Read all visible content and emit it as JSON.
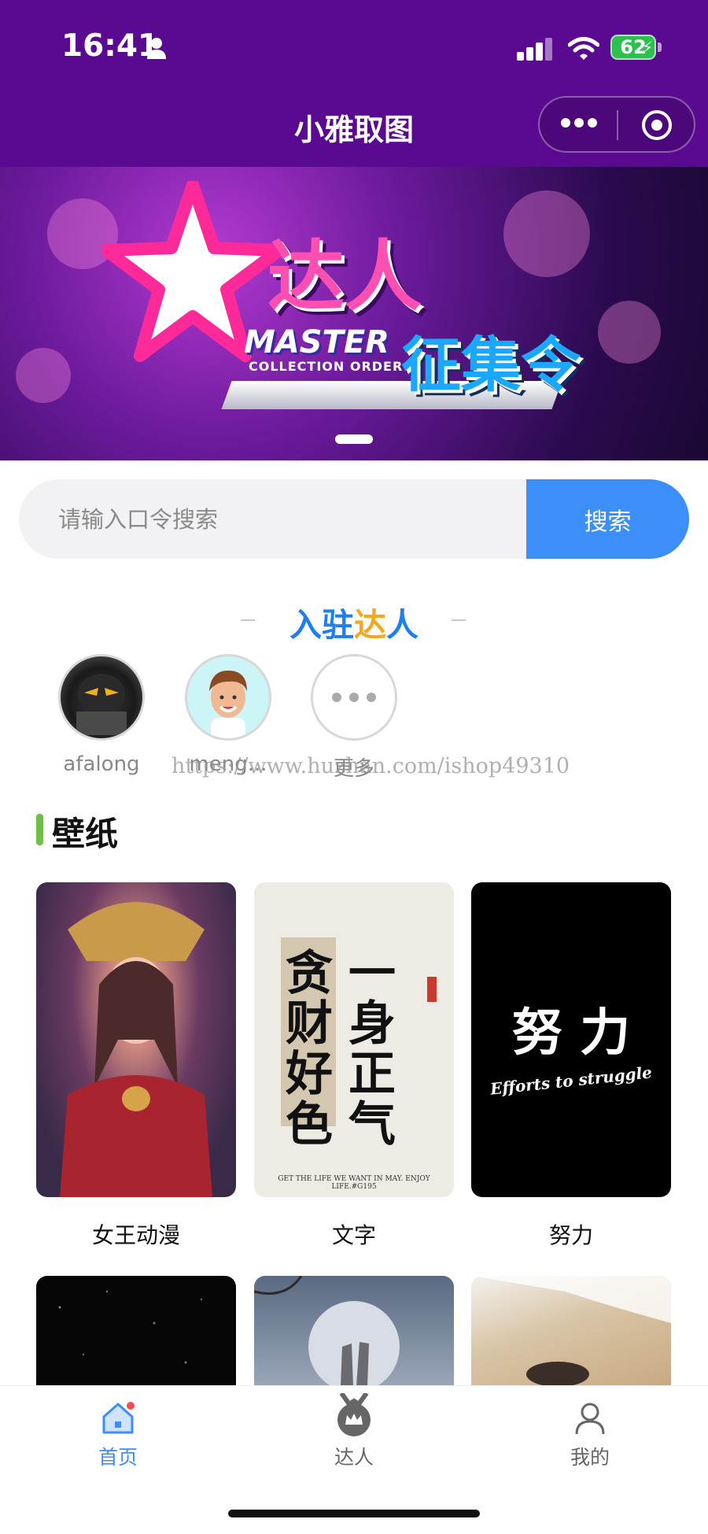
{
  "status_bar": {
    "time": "16:41",
    "battery": "62"
  },
  "nav": {
    "title": "小雅取图"
  },
  "banner": {
    "title": "达人",
    "master": "MASTER",
    "subtitle": "COLLECTION ORDER",
    "call": "征集令"
  },
  "search": {
    "placeholder": "请输入口令搜索",
    "button_label": "搜索"
  },
  "experts": {
    "heading_part1": "入驻",
    "heading_part2": "达",
    "heading_part3": "人",
    "items": [
      {
        "name": "afalong"
      },
      {
        "name": "meng..."
      },
      {
        "name": "更多"
      }
    ],
    "watermark": "https://www.huzhan.com/ishop49310"
  },
  "wallpaper": {
    "section_title": "壁纸",
    "cards": [
      {
        "label": "女王动漫"
      },
      {
        "label": "文字",
        "art_text": [
          "贪财好色",
          "一身正气"
        ],
        "caption": "GET THE LIFE WE WANT IN MAY. ENJOY LIFE.#G195"
      },
      {
        "label": "努力",
        "art_text": "努 力",
        "caption": "Efforts to struggle"
      }
    ]
  },
  "tabbar": {
    "items": [
      {
        "label": "首页",
        "icon": "home-icon",
        "active": true
      },
      {
        "label": "达人",
        "icon": "medal-icon",
        "active": false
      },
      {
        "label": "我的",
        "icon": "user-icon",
        "active": false
      }
    ],
    "active_color": "#3c8ef8",
    "inactive_color": "#666666"
  },
  "colors": {
    "nav_bg": "#5a0a91",
    "accent": "#3c8ef8",
    "section_bar": "#6cc04a"
  }
}
